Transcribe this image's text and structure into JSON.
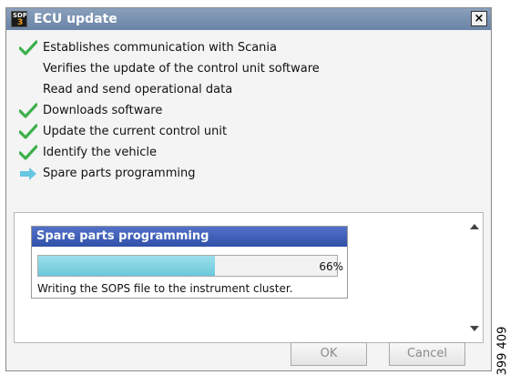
{
  "window": {
    "title": "ECU update",
    "icon": {
      "name": "sdp3-app-icon",
      "text_top": "SDP",
      "text_bottom": "3"
    },
    "close_label": "×"
  },
  "steps": [
    {
      "label": "Establishes communication with Scania",
      "status": "done",
      "icon": "check-icon"
    },
    {
      "label": "Verifies the update of the control unit software",
      "status": "pending",
      "icon": ""
    },
    {
      "label": "Read and send operational data",
      "status": "pending",
      "icon": ""
    },
    {
      "label": "Downloads software",
      "status": "done",
      "icon": "check-icon"
    },
    {
      "label": "Update the current control unit",
      "status": "done",
      "icon": "check-icon"
    },
    {
      "label": "Identify the vehicle",
      "status": "done",
      "icon": "check-icon"
    },
    {
      "label": "Spare parts programming",
      "status": "current",
      "icon": "arrow-right-icon"
    }
  ],
  "progress": {
    "title": "Spare parts programming",
    "value": 0.66,
    "percent_label": "66%",
    "message": "Writing the SOPS file to the instrument cluster."
  },
  "buttons": {
    "ok": "OK",
    "cancel": "Cancel"
  },
  "doc_code": "399 409",
  "colors": {
    "check": "#3cb04a",
    "arrow": "#66c8e0",
    "title_bar": "#7a92b4",
    "progress_header": "#3f5fb8",
    "progress_fill": "#8fd8e8"
  }
}
